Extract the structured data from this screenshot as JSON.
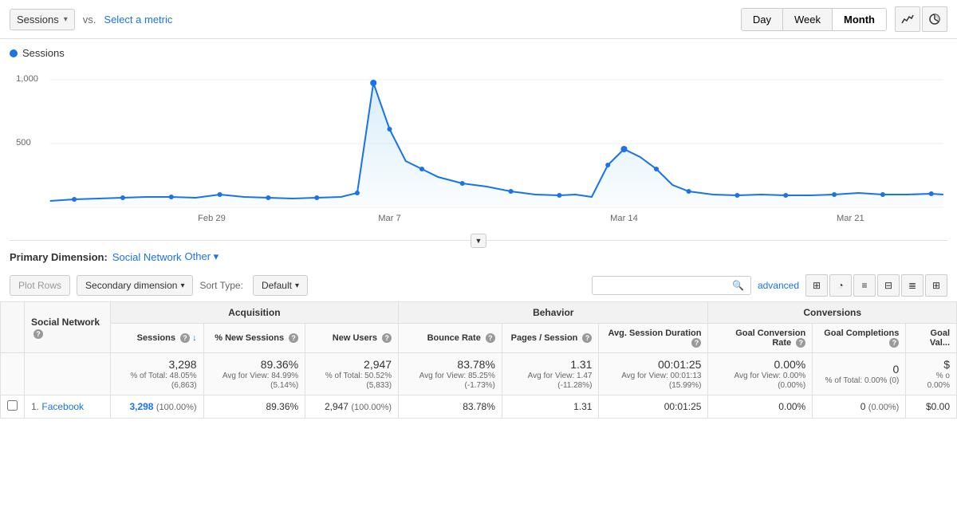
{
  "topBar": {
    "metricDropdown": "Sessions",
    "vsText": "vs.",
    "selectMetric": "Select a metric",
    "timeButtons": [
      "Day",
      "Week",
      "Month"
    ],
    "activeTimeButton": "Month"
  },
  "chart": {
    "legendLabel": "Sessions",
    "yLabels": [
      "1,000",
      "500"
    ],
    "xLabels": [
      "Feb 29",
      "Mar 7",
      "Mar 14",
      "Mar 21"
    ]
  },
  "primaryDimension": {
    "label": "Primary Dimension:",
    "network": "Social Network",
    "other": "Other ▾"
  },
  "controls": {
    "plotRows": "Plot Rows",
    "secondaryDimension": "Secondary dimension",
    "sortTypeLabel": "Sort Type:",
    "sortTypeValue": "Default",
    "advanced": "advanced"
  },
  "tableGroups": {
    "acquisition": "Acquisition",
    "behavior": "Behavior",
    "conversions": "Conversions"
  },
  "tableHeaders": {
    "socialNetwork": "Social Network",
    "sessions": "Sessions",
    "pctNewSessions": "% New Sessions",
    "newUsers": "New Users",
    "bounceRate": "Bounce Rate",
    "pagesPerSession": "Pages / Session",
    "avgSessionDuration": "Avg. Session Duration",
    "goalConversionRate": "Goal Conversion Rate",
    "goalCompletions": "Goal Completions",
    "goalValue": "Goal Val..."
  },
  "totalsRow": {
    "sessions": "3,298",
    "sessionsPct": "% of Total: 48.05% (6,863)",
    "pctNewSessions": "89.36%",
    "pctNewSessionsAvg": "Avg for View: 84.99% (5.14%)",
    "newUsers": "2,947",
    "newUsersPct": "% of Total: 50.52% (5,833)",
    "bounceRate": "83.78%",
    "bounceRateAvg": "Avg for View: 85.25% (-1.73%)",
    "pagesPerSession": "1.31",
    "pagesAvg": "Avg for View: 1.47 (-11.28%)",
    "avgSessionDuration": "00:01:25",
    "avgDurationAvg": "Avg for View: 00:01:13 (15.99%)",
    "goalConversionRate": "0.00%",
    "goalConvAvg": "Avg for View: 0.00% (0.00%)",
    "goalCompletions": "0",
    "goalCompPct": "% of Total: 0.00% (0)",
    "goalValue": "$",
    "goalValuePct": "% o 0.00%"
  },
  "dataRows": [
    {
      "num": "1.",
      "name": "Facebook",
      "sessions": "3,298",
      "sessionsPct": "(100.00%)",
      "pctNewSessions": "89.36%",
      "newUsers": "2,947",
      "newUsersPct": "(100.00%)",
      "bounceRate": "83.78%",
      "pagesPerSession": "1.31",
      "avgSessionDuration": "00:01:25",
      "goalConversionRate": "0.00%",
      "goalCompletions": "0",
      "goalCompPct": "(0.00%)",
      "goalValue": "$0.00"
    }
  ]
}
